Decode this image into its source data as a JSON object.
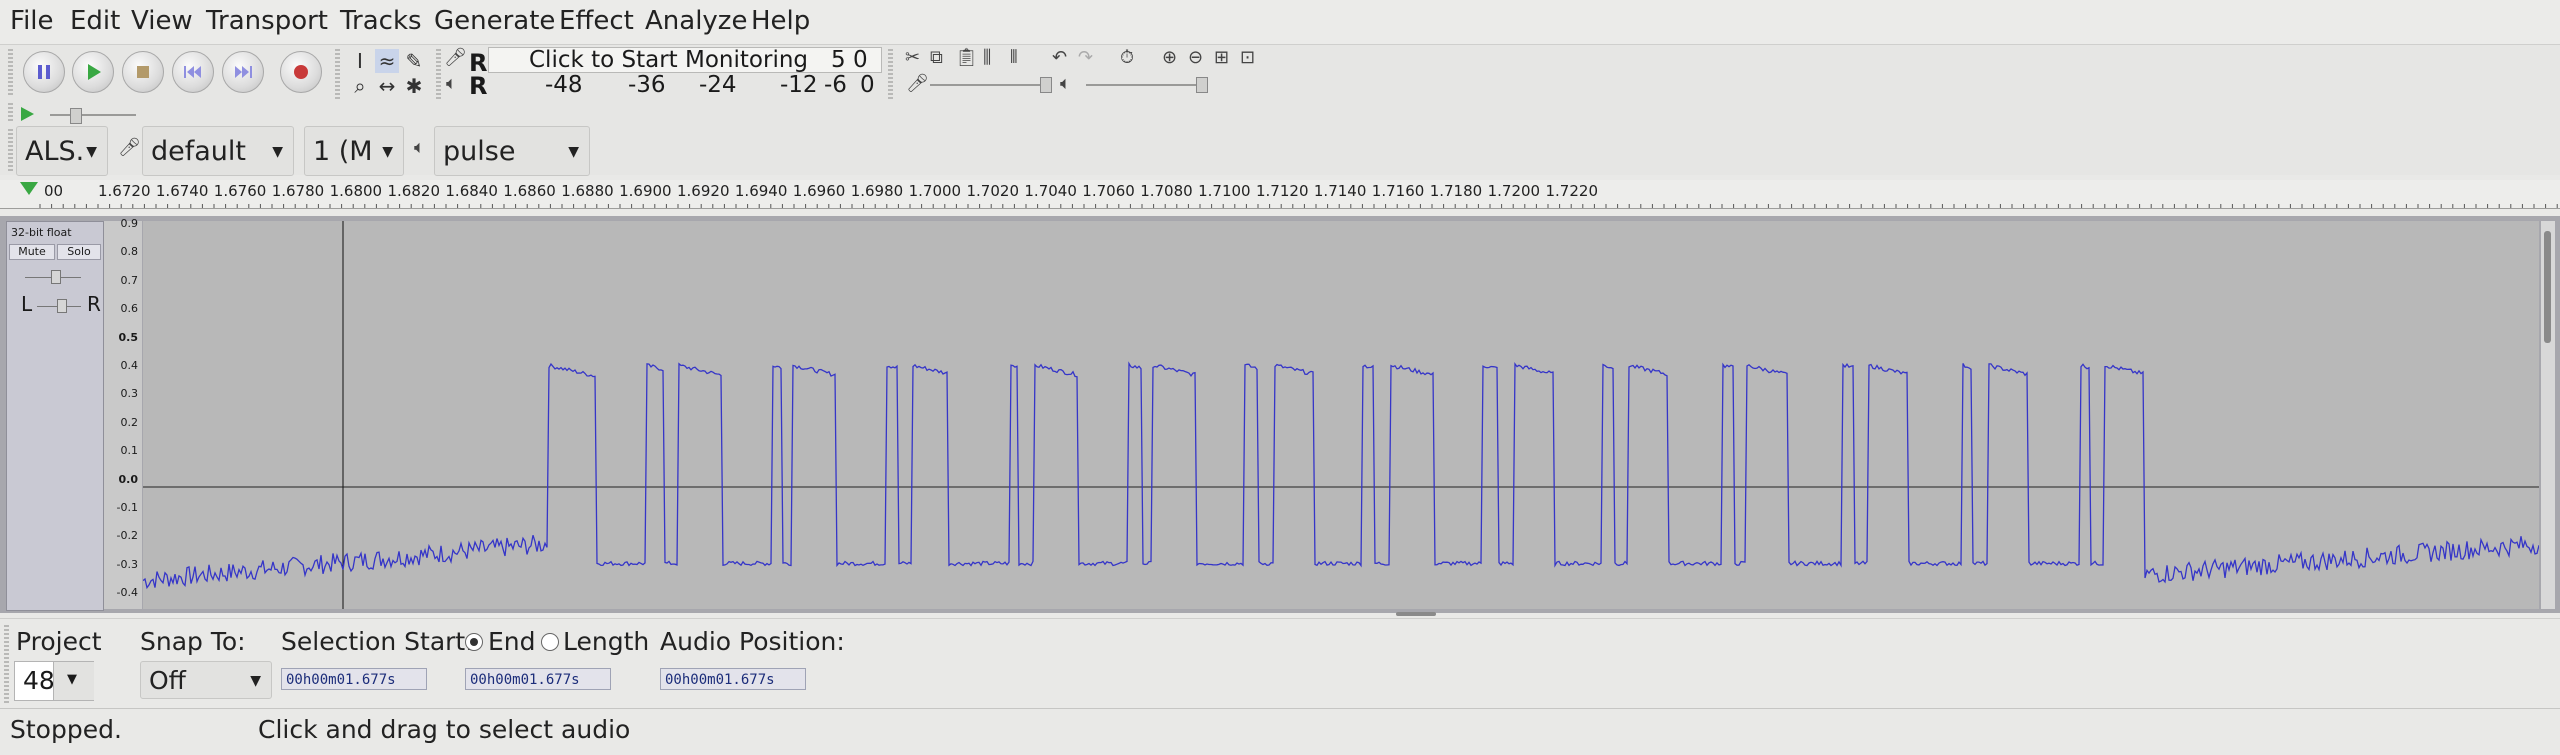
{
  "menubar": {
    "items": [
      "File",
      "Edit",
      "View",
      "Transport",
      "Tracks",
      "Generate",
      "Effect",
      "Analyze",
      "Help"
    ]
  },
  "transport": {
    "pause": "pause-icon",
    "play": "play-icon",
    "stop": "stop-icon",
    "skip_start": "skip-to-start-icon",
    "skip_end": "skip-to-end-icon",
    "record": "record-icon"
  },
  "meter": {
    "monitor_label": "Click to Start Monitoring",
    "record_scale_tail": "5 0",
    "playback_scale": [
      "-48",
      "-36",
      "-24",
      "-12",
      "-6",
      "0"
    ],
    "record_channel": "R",
    "playback_channel": "R"
  },
  "device": {
    "host": "ALS.",
    "input_device": "default",
    "channels": "1 (M",
    "output_device": "pulse"
  },
  "ruler": {
    "labels": [
      "00",
      "1.6720",
      "1.6740",
      "1.6760",
      "1.6780",
      "1.6800",
      "1.6820",
      "1.6840",
      "1.6860",
      "1.6880",
      "1.6900",
      "1.6920",
      "1.6940",
      "1.6960",
      "1.6980",
      "1.7000",
      "1.7020",
      "1.7040",
      "1.7060",
      "1.7080",
      "1.7100",
      "1.7120",
      "1.7140",
      "1.7160",
      "1.7180",
      "1.7200",
      "1.7220"
    ]
  },
  "track": {
    "format": "32-bit float",
    "mute": "Mute",
    "solo": "Solo",
    "pan_left": "L",
    "pan_right": "R",
    "y_labels": [
      "0.9",
      "0.8",
      "0.7",
      "0.6",
      "0.5",
      "0.4",
      "0.3",
      "0.2",
      "0.1",
      "0.0",
      "-0.1",
      "-0.2",
      "-0.3",
      "-0.4"
    ]
  },
  "selection": {
    "project_rate_label": "Project",
    "project_rate_value": "48",
    "snap_label": "Snap To:",
    "snap_value": "Off",
    "selection_start_label": "Selection Start:",
    "end_label": "End",
    "length_label": "Length",
    "audio_position_label": "Audio Position:",
    "start_time": "00h00m01.677s",
    "end_time": "00h00m01.677s",
    "audio_position_time": "00h00m01.677s"
  },
  "status": {
    "state": "Stopped.",
    "hint": "Click and drag to select audio"
  },
  "colors": {
    "waveform": "#3535c8",
    "record": "#c83a3a",
    "play": "#39a843",
    "transport_icons": "#6b6bd8"
  }
}
